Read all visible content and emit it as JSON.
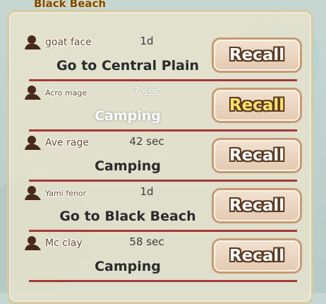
{
  "map_label": "Black Beach",
  "button_label": "Recall",
  "rows": [
    {
      "name": "goat face",
      "time": "1d",
      "action": "Go to Central Plain"
    },
    {
      "name": "Acro mage",
      "time": "7 sec",
      "action": "Camping"
    },
    {
      "name": "Ave rage",
      "time": "42 sec",
      "action": "Camping"
    },
    {
      "name": "Yami fenor",
      "time": "1d",
      "action": "Go to Black Beach"
    },
    {
      "name": "Mc clay",
      "time": "58 sec",
      "action": "Camping"
    }
  ],
  "colors": {
    "divider": "#a33a3a",
    "button_text_default": "#ffffff",
    "button_text_active": "#ffe36a",
    "text_dark": "#2b2b2b"
  }
}
